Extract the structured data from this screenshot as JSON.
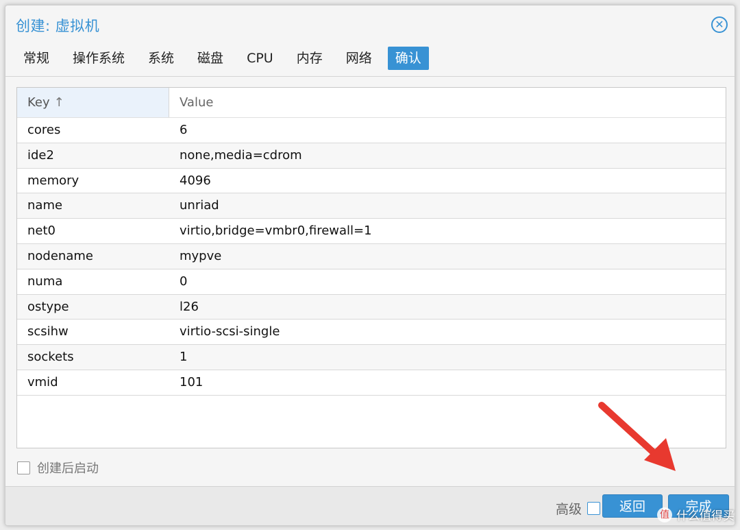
{
  "dialog": {
    "title": "创建: 虚拟机",
    "close_glyph": "✕"
  },
  "tabs": [
    {
      "label": "常规",
      "active": false
    },
    {
      "label": "操作系统",
      "active": false
    },
    {
      "label": "系统",
      "active": false
    },
    {
      "label": "磁盘",
      "active": false
    },
    {
      "label": "CPU",
      "active": false
    },
    {
      "label": "内存",
      "active": false
    },
    {
      "label": "网络",
      "active": false
    },
    {
      "label": "确认",
      "active": true
    }
  ],
  "grid": {
    "columns": {
      "key": "Key",
      "value": "Value"
    },
    "sort_glyph": "↑",
    "rows": [
      {
        "key": "cores",
        "value": "6"
      },
      {
        "key": "ide2",
        "value": "none,media=cdrom"
      },
      {
        "key": "memory",
        "value": "4096"
      },
      {
        "key": "name",
        "value": "unriad"
      },
      {
        "key": "net0",
        "value": "virtio,bridge=vmbr0,firewall=1"
      },
      {
        "key": "nodename",
        "value": "mypve"
      },
      {
        "key": "numa",
        "value": "0"
      },
      {
        "key": "ostype",
        "value": "l26"
      },
      {
        "key": "scsihw",
        "value": "virtio-scsi-single"
      },
      {
        "key": "sockets",
        "value": "1"
      },
      {
        "key": "vmid",
        "value": "101"
      }
    ]
  },
  "autostart": {
    "label": "创建后启动",
    "checked": false
  },
  "footer": {
    "advanced_label": "高级",
    "advanced_checked": false,
    "back_label": "返回",
    "finish_label": "完成"
  },
  "watermark": {
    "badge": "值",
    "text": "什么值得买"
  },
  "colors": {
    "accent": "#3892d4",
    "arrow": "#e8392f"
  }
}
